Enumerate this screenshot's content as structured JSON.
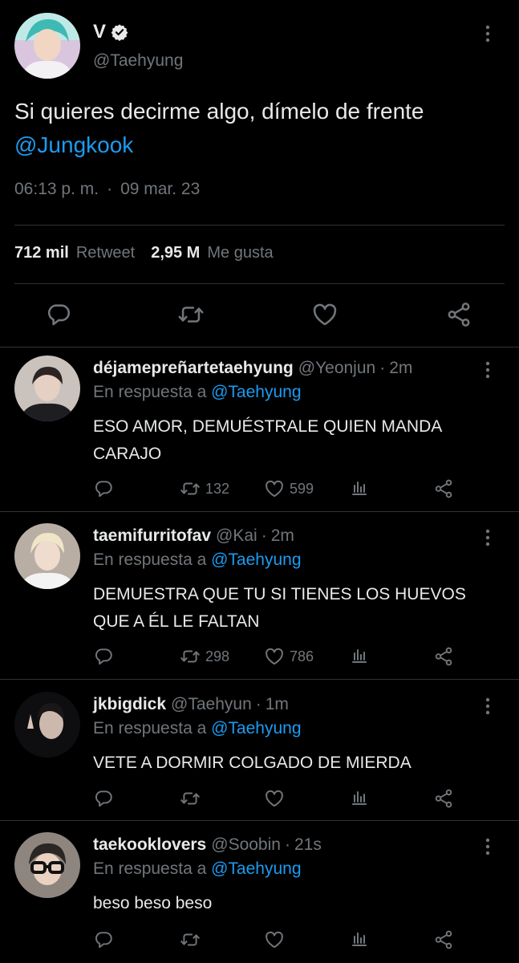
{
  "tweet": {
    "author_name": "V",
    "author_handle": "@Taehyung",
    "text": "Si quieres decirme algo, dímelo de frente",
    "mention": "@Jungkook",
    "time": "06:13 p. m.",
    "dot": "·",
    "date": "09 mar. 23",
    "retweets": "712 mil",
    "retweets_label": "Retweet",
    "likes": "2,95 M",
    "likes_label": "Me gusta"
  },
  "reply_prefix": "En respuesta a",
  "replies": [
    {
      "name": "déjamepreñartetaehyung",
      "handle": "@Yeonjun",
      "time_sep": "·",
      "time": "2m",
      "in_reply_to": "@Taehyung",
      "text": "ESO AMOR, DEMUÉSTRALE QUIEN MANDA CARAJO",
      "retweets": "132",
      "likes": "599"
    },
    {
      "name": "taemifurritofav",
      "handle": "@Kai",
      "time_sep": "·",
      "time": "2m",
      "in_reply_to": "@Taehyung",
      "text": "DEMUESTRA QUE TU SI TIENES LOS HUEVOS QUE A ÉL LE FALTAN",
      "retweets": "298",
      "likes": "786"
    },
    {
      "name": "jkbigdick",
      "handle": "@Taehyun",
      "time_sep": "·",
      "time": "1m",
      "in_reply_to": "@Taehyung",
      "text": "VETE A DORMIR COLGADO DE MIERDA",
      "retweets": "",
      "likes": ""
    },
    {
      "name": "taekooklovers",
      "handle": "@Soobin",
      "time_sep": "·",
      "time": "21s",
      "in_reply_to": "@Taehyung",
      "text": "beso beso beso",
      "retweets": "",
      "likes": ""
    }
  ],
  "colors": {
    "background": "#000000",
    "text": "#e7e9ea",
    "secondary": "#71767b",
    "accent": "#1d9bf0",
    "divider": "#2f3336"
  }
}
